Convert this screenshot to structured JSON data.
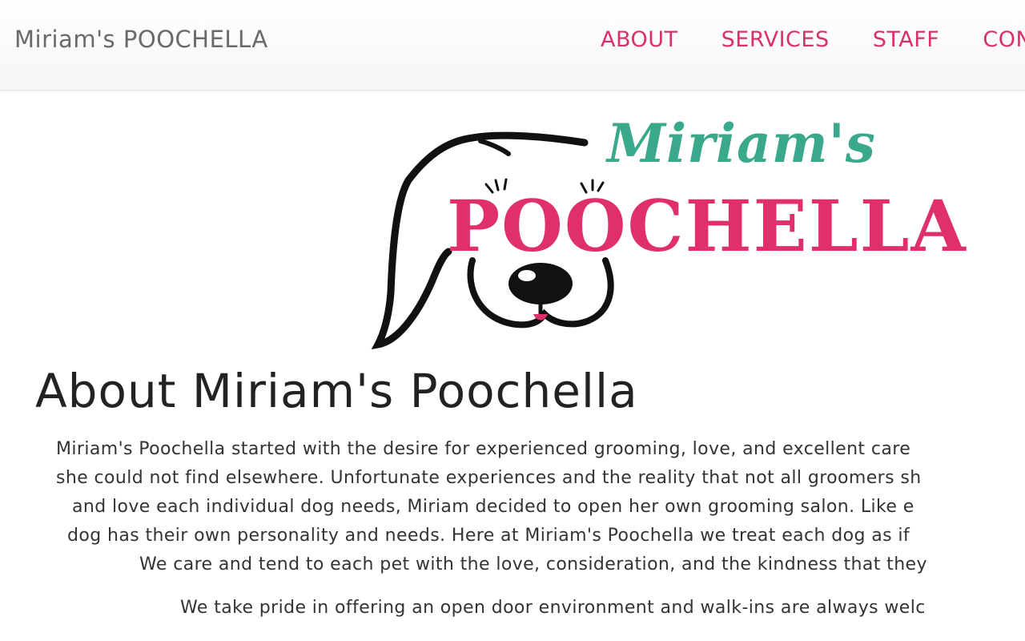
{
  "navbar": {
    "brand": "Miriam's POOCHELLA",
    "links": [
      "ABOUT",
      "SERVICES",
      "STAFF",
      "CON"
    ]
  },
  "logo": {
    "line1": "Miriam's",
    "line2": "POOCHELLA"
  },
  "about": {
    "title": "About Miriam's Poochella",
    "lines": [
      "Miriam's Poochella started with the desire for experienced grooming, love, and excellent care",
      "she could not find elsewhere. Unfortunate experiences and the reality that not all groomers sh",
      "and love each individual dog needs, Miriam decided to open her own grooming salon. Like e",
      "dog has their own personality and needs. Here at Miriam's Poochella we treat each dog as if",
      "We care and tend to each pet with the love, consideration, and the kindness that they",
      "We take pride in offering an open door environment and walk-ins are always welc"
    ]
  },
  "colors": {
    "accent_pink": "#d9306c",
    "logo_teal": "#3aa88b",
    "logo_pink": "#e0306b"
  }
}
